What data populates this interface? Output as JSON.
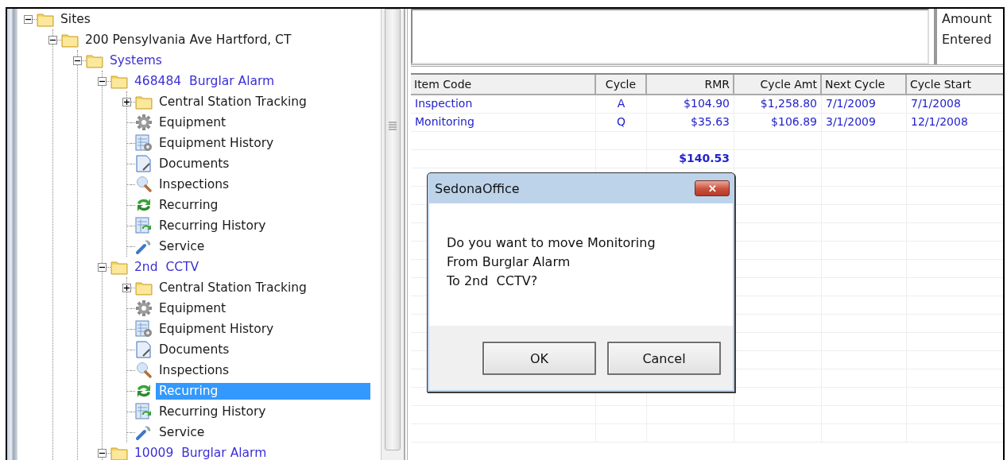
{
  "tree": [
    {
      "label": "Sites",
      "kind": "folder",
      "expanded": true,
      "selected": false,
      "children": [
        {
          "label": "200 Pensylvania Ave Hartford, CT",
          "kind": "folder",
          "expanded": true,
          "selected": false,
          "children": [
            {
              "label": "Systems",
              "kind": "system",
              "expanded": true,
              "selected": false,
              "children": [
                {
                  "label": "468484  Burglar Alarm",
                  "kind": "system",
                  "expanded": true,
                  "selected": false,
                  "children": [
                    {
                      "label": "Central Station Tracking",
                      "kind": "folder",
                      "expanded": false,
                      "selected": false
                    },
                    {
                      "label": "Equipment",
                      "kind": "gear",
                      "selected": false
                    },
                    {
                      "label": "Equipment History",
                      "kind": "equipment-history",
                      "selected": false
                    },
                    {
                      "label": "Documents",
                      "kind": "document",
                      "selected": false
                    },
                    {
                      "label": "Inspections",
                      "kind": "inspection",
                      "selected": false
                    },
                    {
                      "label": "Recurring",
                      "kind": "recurring",
                      "selected": false
                    },
                    {
                      "label": "Recurring History",
                      "kind": "recurring-history",
                      "selected": false
                    },
                    {
                      "label": "Service",
                      "kind": "service",
                      "selected": false
                    }
                  ]
                },
                {
                  "label": "2nd  CCTV",
                  "kind": "system",
                  "expanded": true,
                  "selected": false,
                  "children": [
                    {
                      "label": "Central Station Tracking",
                      "kind": "folder",
                      "expanded": false,
                      "selected": false
                    },
                    {
                      "label": "Equipment",
                      "kind": "gear",
                      "selected": false
                    },
                    {
                      "label": "Equipment History",
                      "kind": "equipment-history",
                      "selected": false
                    },
                    {
                      "label": "Documents",
                      "kind": "document",
                      "selected": false
                    },
                    {
                      "label": "Inspections",
                      "kind": "inspection",
                      "selected": false
                    },
                    {
                      "label": "Recurring",
                      "kind": "recurring",
                      "selected": true
                    },
                    {
                      "label": "Recurring History",
                      "kind": "recurring-history",
                      "selected": false
                    },
                    {
                      "label": "Service",
                      "kind": "service",
                      "selected": false
                    }
                  ]
                },
                {
                  "label": "10009  Burglar Alarm",
                  "kind": "system",
                  "expanded": true,
                  "selected": false
                }
              ]
            }
          ]
        }
      ]
    }
  ],
  "top_panel": {
    "labels": [
      "Amount",
      "Entered"
    ]
  },
  "grid": {
    "columns": [
      "Item Code",
      "Cycle",
      "RMR",
      "Cycle Amt",
      "Next Cycle",
      "Cycle Start"
    ],
    "rows": [
      {
        "kind": "item",
        "cells": [
          "Inspection",
          "A",
          "$104.90",
          "$1,258.80",
          "7/1/2009",
          "7/1/2008"
        ]
      },
      {
        "kind": "item",
        "cells": [
          "Monitoring",
          "Q",
          "$35.63",
          "$106.89",
          "3/1/2009",
          "12/1/2008"
        ]
      },
      {
        "kind": "blank"
      },
      {
        "kind": "total",
        "value": "$140.53"
      }
    ]
  },
  "dialog": {
    "title": "SedonaOffice",
    "close": "✕",
    "message": [
      "Do you want to move Monitoring",
      "From Burglar Alarm",
      "To 2nd  CCTV?"
    ],
    "buttons": [
      "OK",
      "Cancel"
    ]
  }
}
